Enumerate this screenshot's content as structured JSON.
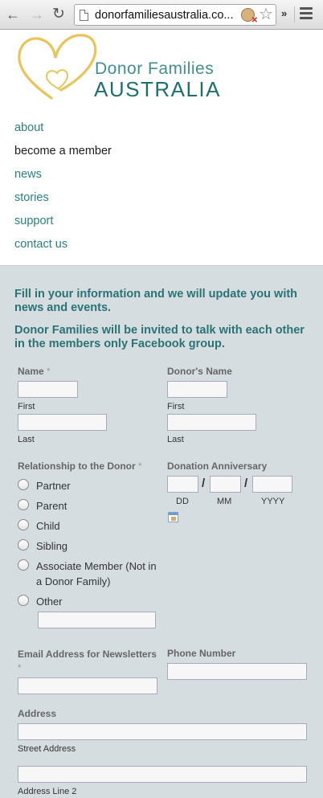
{
  "browser": {
    "url": "donorfamiliesaustralia.co..."
  },
  "brand": {
    "line1": "Donor Families",
    "line2": "AUSTRALIA",
    "logo_color": "#e8c45a",
    "text_color": "#1e6f72"
  },
  "nav": {
    "items": [
      {
        "label": "about"
      },
      {
        "label": "become a member"
      },
      {
        "label": "news"
      },
      {
        "label": "stories"
      },
      {
        "label": "support"
      },
      {
        "label": "contact us"
      }
    ]
  },
  "form": {
    "intro1": "Fill in your information and we will update you with news and events.",
    "intro2": "Donor Families will be invited to talk with each other in the members only Facebook group.",
    "name": {
      "label": "Name",
      "required": "*",
      "first": "First",
      "last": "Last"
    },
    "donor_name": {
      "label": "Donor's Name",
      "first": "First",
      "last": "Last"
    },
    "relationship": {
      "label": "Relationship to the Donor",
      "required": "*",
      "options": [
        "Partner",
        "Parent",
        "Child",
        "Sibling",
        "Associate Member (Not in a Donor Family)",
        "Other"
      ]
    },
    "anniversary": {
      "label": "Donation Anniversary",
      "dd": "DD",
      "mm": "MM",
      "yyyy": "YYYY",
      "sep": "/"
    },
    "email": {
      "label": "Email Address for Newsletters",
      "required": "*"
    },
    "phone": {
      "label": "Phone Number"
    },
    "address": {
      "label": "Address",
      "street": "Street Address",
      "line2": "Address Line 2"
    }
  }
}
